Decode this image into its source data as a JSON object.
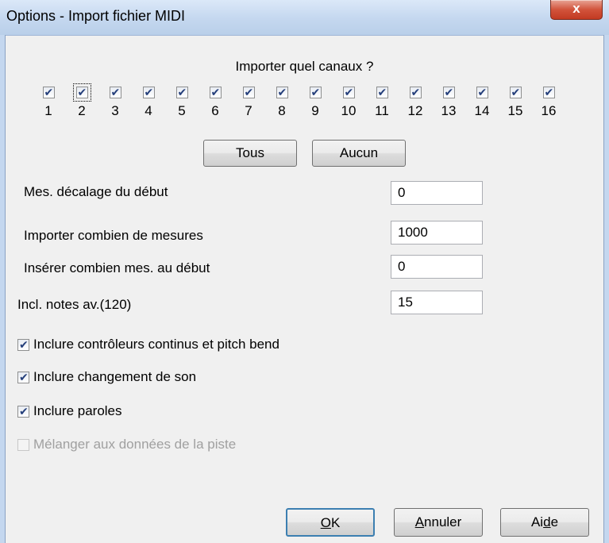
{
  "window": {
    "title": "Options - Import fichier MIDI",
    "close_label": "x"
  },
  "channels": {
    "heading": "Importer quel canaux ?",
    "items": [
      {
        "num": "1",
        "checked": true
      },
      {
        "num": "2",
        "checked": true,
        "focused": true
      },
      {
        "num": "3",
        "checked": true
      },
      {
        "num": "4",
        "checked": true
      },
      {
        "num": "5",
        "checked": true
      },
      {
        "num": "6",
        "checked": true
      },
      {
        "num": "7",
        "checked": true
      },
      {
        "num": "8",
        "checked": true
      },
      {
        "num": "9",
        "checked": true
      },
      {
        "num": "10",
        "checked": true
      },
      {
        "num": "11",
        "checked": true
      },
      {
        "num": "12",
        "checked": true
      },
      {
        "num": "13",
        "checked": true
      },
      {
        "num": "14",
        "checked": true
      },
      {
        "num": "15",
        "checked": true
      },
      {
        "num": "16",
        "checked": true
      }
    ],
    "all_label": "Tous",
    "none_label": "Aucun"
  },
  "fields": [
    {
      "label": "Mes. décalage du début",
      "value": "0"
    },
    {
      "label": "Importer combien de mesures",
      "value": "1000"
    },
    {
      "label": "Insérer combien mes. au début",
      "value": "0"
    },
    {
      "label": "Incl. notes av.(120)",
      "value": "15"
    }
  ],
  "options": [
    {
      "label": "Inclure contrôleurs continus et pitch bend",
      "checked": true,
      "enabled": true
    },
    {
      "label": "Inclure changement de son",
      "checked": true,
      "enabled": true
    },
    {
      "label": "Inclure paroles",
      "checked": true,
      "enabled": true
    },
    {
      "label": "Mélanger aux données de la piste",
      "checked": false,
      "enabled": false
    }
  ],
  "buttons": {
    "ok": {
      "pre": "",
      "ul": "O",
      "post": "K"
    },
    "cancel": {
      "pre": "",
      "ul": "A",
      "post": "nnuler"
    },
    "help": {
      "pre": "Ai",
      "ul": "d",
      "post": "e"
    }
  },
  "colors": {
    "check": "#253f7b",
    "title_bar": "#c4d7ef",
    "close_button": "#d2543c",
    "dialog_bg": "#f0f0f0"
  }
}
